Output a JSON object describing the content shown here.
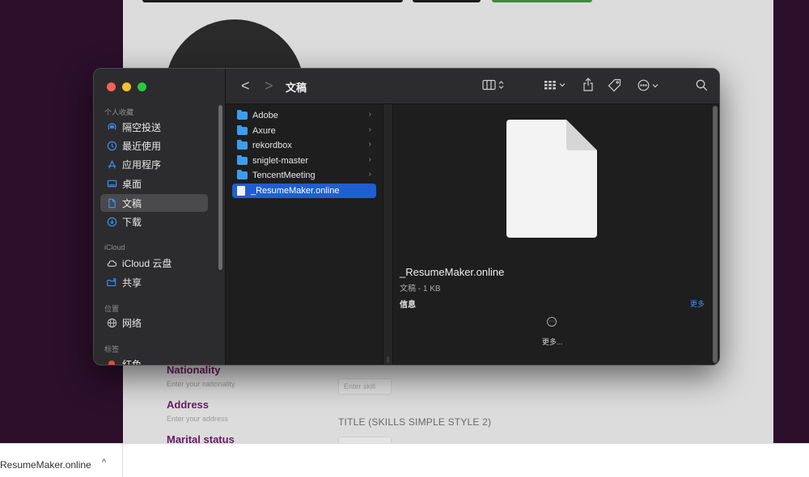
{
  "background": {
    "fields": [
      {
        "label": "Nationality",
        "hint": "Enter your nationality"
      },
      {
        "label": "Address",
        "hint": "Enter your address"
      },
      {
        "label": "Marital status",
        "hint": ""
      }
    ],
    "sections": [
      "TITLE (SKILLS SIMPLE STYLE 2)"
    ],
    "skill_placeholder": "Enter skill"
  },
  "download_bar": {
    "file_name": "ResumeMaker.online",
    "chevron": "^"
  },
  "finder": {
    "title": "文稿",
    "nav": {
      "back": "<",
      "forward": ">"
    },
    "sidebar": {
      "favorites_label": "个人收藏",
      "favorites": [
        {
          "label": "隔空投送",
          "icon": "airdrop-icon"
        },
        {
          "label": "最近使用",
          "icon": "clock-icon"
        },
        {
          "label": "应用程序",
          "icon": "apps-icon"
        },
        {
          "label": "桌面",
          "icon": "desktop-icon"
        },
        {
          "label": "文稿",
          "icon": "document-icon"
        },
        {
          "label": "下载",
          "icon": "download-icon"
        }
      ],
      "icloud_label": "iCloud",
      "icloud": [
        {
          "label": "iCloud 云盘",
          "icon": "cloud-icon"
        },
        {
          "label": "共享",
          "icon": "shared-folder-icon"
        }
      ],
      "locations_label": "位置",
      "locations": [
        {
          "label": "网络",
          "icon": "network-icon"
        }
      ],
      "tags_label": "标签",
      "tags": [
        {
          "label": "红色",
          "icon": "red-tag-icon"
        }
      ]
    },
    "items": [
      {
        "name": "Adobe",
        "type": "folder"
      },
      {
        "name": "Axure",
        "type": "folder"
      },
      {
        "name": "rekordbox",
        "type": "folder"
      },
      {
        "name": "sniglet-master",
        "type": "folder"
      },
      {
        "name": "TencentMeeting",
        "type": "folder"
      },
      {
        "name": "_ResumeMaker.online",
        "type": "file"
      }
    ],
    "preview": {
      "name": "_ResumeMaker.online",
      "subtitle": "文稿 - 1 KB",
      "info_label": "信息",
      "more_link": "更多",
      "more_button": "更多..."
    }
  }
}
